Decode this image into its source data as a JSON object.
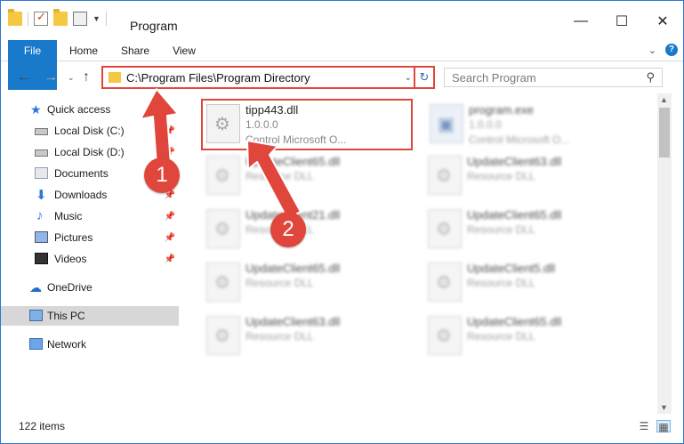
{
  "window": {
    "title": "Program",
    "minimize": "—",
    "maximize": "☐",
    "close": "✕"
  },
  "ribbon": {
    "tabs": [
      "File",
      "Home",
      "Share",
      "View"
    ]
  },
  "address": {
    "path": "C:\\Program Files\\Program Directory",
    "search_placeholder": "Search Program"
  },
  "sidebar": {
    "items": [
      {
        "label": "Quick access"
      },
      {
        "label": "Local Disk (C:)"
      },
      {
        "label": "Local Disk (D:)"
      },
      {
        "label": "Documents"
      },
      {
        "label": "Downloads"
      },
      {
        "label": "Music"
      },
      {
        "label": "Pictures"
      },
      {
        "label": "Videos"
      },
      {
        "label": "OneDrive"
      },
      {
        "label": "This PC"
      },
      {
        "label": "Network"
      }
    ]
  },
  "files": [
    {
      "name": "tipp443.dll",
      "line1": "1.0.0.0",
      "line2": "Control Microsoft O..."
    },
    {
      "name": "program.exe",
      "line1": "1.0.0.0",
      "line2": "Control Microsoft O..."
    },
    {
      "name": "UpdateClient65.dll",
      "line1": "Resource DLL"
    },
    {
      "name": "UpdateClient63.dll",
      "line1": "Resource DLL"
    },
    {
      "name": "UpdateClient21.dll",
      "line1": "Resource DLL"
    },
    {
      "name": "UpdateClient65.dll",
      "line1": "Resource DLL"
    },
    {
      "name": "UpdateClient65.dll",
      "line1": "Resource DLL"
    },
    {
      "name": "UpdateClient5.dll",
      "line1": "Resource DLL"
    },
    {
      "name": "UpdateClient63.dll",
      "line1": "Resource DLL"
    },
    {
      "name": "UpdateClient65.dll",
      "line1": "Resource DLL"
    }
  ],
  "status": {
    "items_count": "122 items"
  },
  "callouts": {
    "step1": "1",
    "step2": "2"
  },
  "colors": {
    "accent": "#1979ca",
    "highlight": "#e0463b"
  }
}
